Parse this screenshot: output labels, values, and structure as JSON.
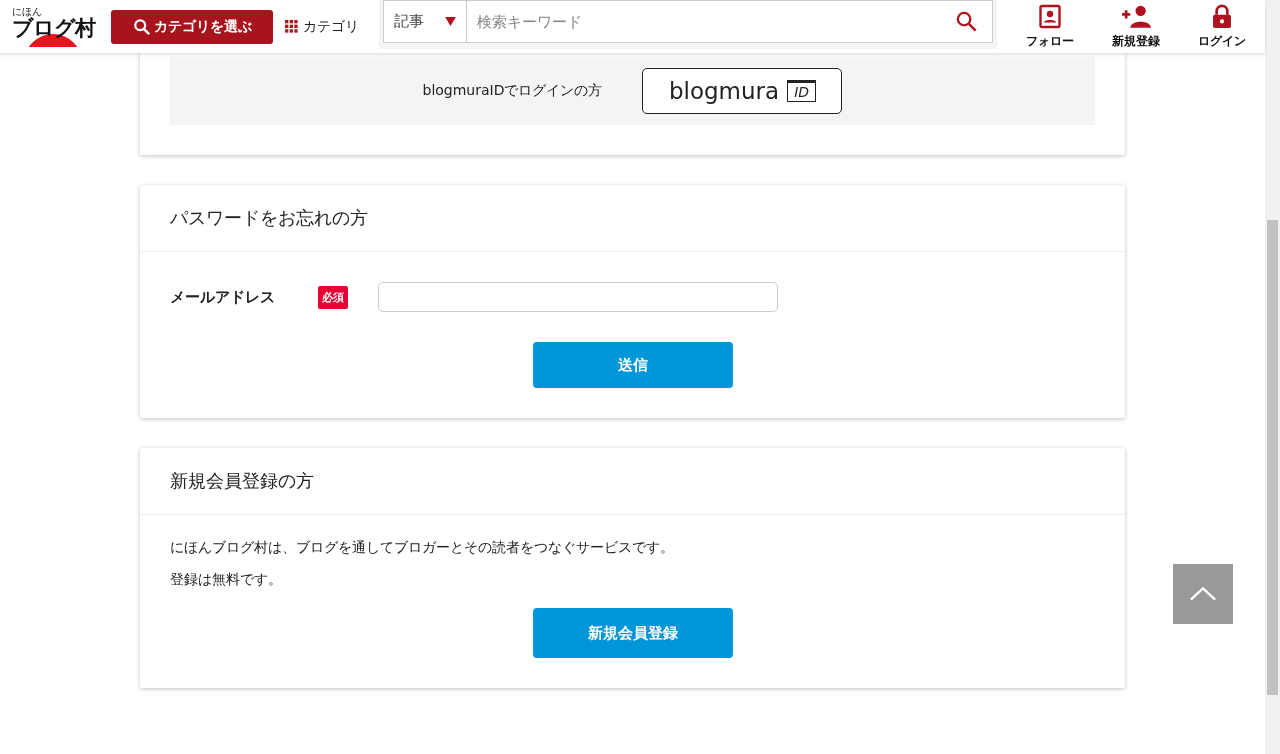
{
  "header": {
    "logo": {
      "small": "にほん",
      "main": "ブログ村"
    },
    "category_button": "カテゴリを選ぶ",
    "category_link": "カテゴリ",
    "search": {
      "type": "記事",
      "placeholder": "検索キーワード"
    },
    "actions": [
      {
        "kind": "follow",
        "label": "フォロー"
      },
      {
        "kind": "register",
        "label": "新規登録"
      },
      {
        "kind": "login",
        "label": "ログイン"
      }
    ]
  },
  "id_login": {
    "text": "blogmuraIDでログインの方",
    "button": "blogmura",
    "badge": "ID"
  },
  "forgot_password": {
    "title": "パスワードをお忘れの方",
    "field_label": "メールアドレス",
    "required": "必須",
    "submit": "送信"
  },
  "register": {
    "title": "新規会員登録の方",
    "lines": [
      "にほんブログ村は、ブログを通してブロガーとその読者をつなぐサービスです。",
      "登録は無料です。"
    ],
    "button": "新規会員登録"
  }
}
